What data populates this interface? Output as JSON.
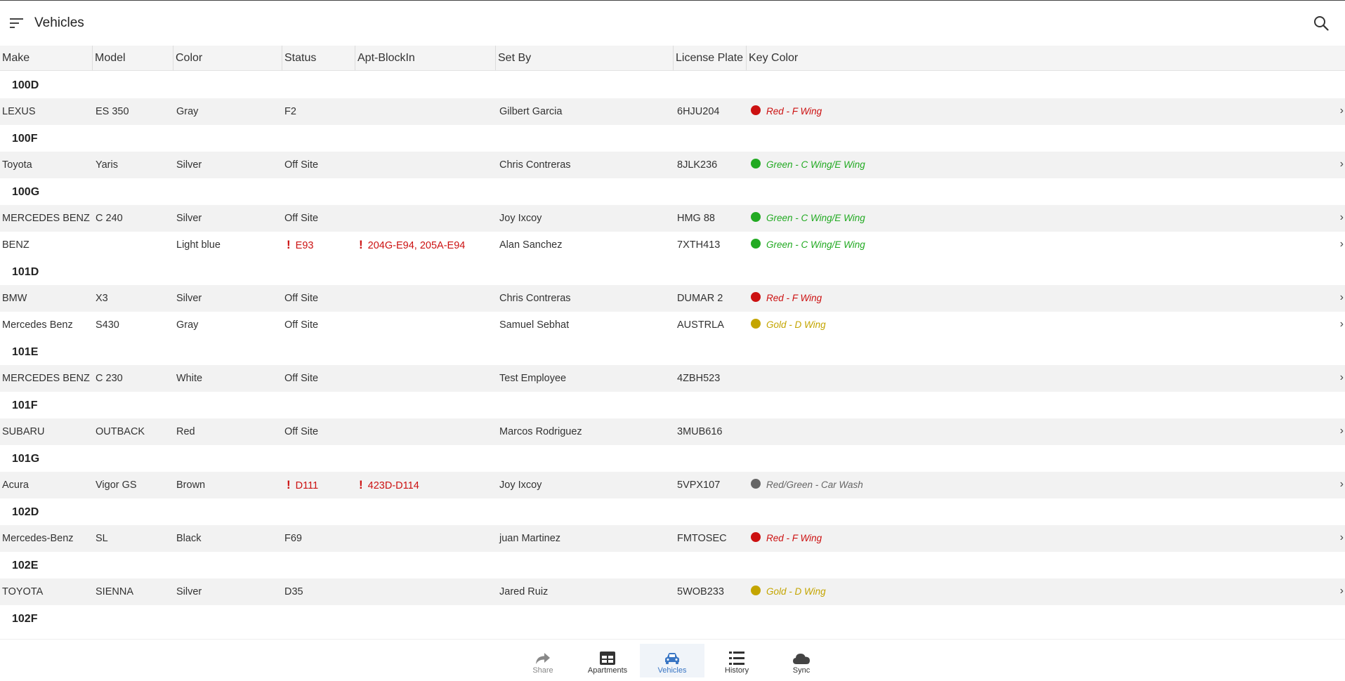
{
  "header": {
    "title": "Vehicles"
  },
  "columns": [
    "Make",
    "Model",
    "Color",
    "Status",
    "Apt-BlockIn",
    "Set By",
    "License Plate",
    "Key Color"
  ],
  "colors": {
    "red": "#cc1111",
    "green": "#22aa22",
    "gold": "#c4a500",
    "gray": "#666666",
    "active_tab": "#3a76c4"
  },
  "groups": [
    {
      "name": "100D",
      "rows": [
        {
          "make": "LEXUS",
          "model": "ES 350",
          "color": "Gray",
          "status": "F2",
          "status_alert": false,
          "apt": "",
          "apt_alert": false,
          "set_by": "Gilbert Garcia",
          "plate": "6HJU204",
          "key": "Red - F Wing",
          "key_color": "#cc1111"
        }
      ]
    },
    {
      "name": "100F",
      "rows": [
        {
          "make": "Toyota",
          "model": "Yaris",
          "color": "Silver",
          "status": "Off Site",
          "status_alert": false,
          "apt": "",
          "apt_alert": false,
          "set_by": "Chris Contreras",
          "plate": "8JLK236",
          "key": "Green - C Wing/E Wing",
          "key_color": "#22aa22"
        }
      ]
    },
    {
      "name": "100G",
      "rows": [
        {
          "make": "MERCEDES BENZ",
          "model": "C 240",
          "color": "Silver",
          "status": "Off Site",
          "status_alert": false,
          "apt": "",
          "apt_alert": false,
          "set_by": "Joy Ixcoy",
          "plate": "HMG 88",
          "key": "Green - C Wing/E Wing",
          "key_color": "#22aa22"
        },
        {
          "make": "BENZ",
          "model": "",
          "color": "Light blue",
          "status": "E93",
          "status_alert": true,
          "apt": "204G-E94, 205A-E94",
          "apt_alert": true,
          "set_by": "Alan Sanchez",
          "plate": "7XTH413",
          "key": "Green - C Wing/E Wing",
          "key_color": "#22aa22"
        }
      ]
    },
    {
      "name": "101D",
      "rows": [
        {
          "make": "BMW",
          "model": "X3",
          "color": "Silver",
          "status": "Off Site",
          "status_alert": false,
          "apt": "",
          "apt_alert": false,
          "set_by": "Chris Contreras",
          "plate": "DUMAR 2",
          "key": "Red - F Wing",
          "key_color": "#cc1111"
        },
        {
          "make": "Mercedes Benz",
          "model": "S430",
          "color": "Gray",
          "status": "Off Site",
          "status_alert": false,
          "apt": "",
          "apt_alert": false,
          "set_by": "Samuel Sebhat",
          "plate": "AUSTRLA",
          "key": "Gold - D Wing",
          "key_color": "#c4a500"
        }
      ]
    },
    {
      "name": "101E",
      "rows": [
        {
          "make": "MERCEDES BENZ",
          "model": "C 230",
          "color": "White",
          "status": "Off Site",
          "status_alert": false,
          "apt": "",
          "apt_alert": false,
          "set_by": "Test Employee",
          "plate": "4ZBH523",
          "key": "",
          "key_color": ""
        }
      ]
    },
    {
      "name": "101F",
      "rows": [
        {
          "make": "SUBARU",
          "model": "OUTBACK",
          "color": "Red",
          "status": "Off Site",
          "status_alert": false,
          "apt": "",
          "apt_alert": false,
          "set_by": "Marcos Rodriguez",
          "plate": "3MUB616",
          "key": "",
          "key_color": ""
        }
      ]
    },
    {
      "name": "101G",
      "rows": [
        {
          "make": "Acura",
          "model": "Vigor GS",
          "color": "Brown",
          "status": "D111",
          "status_alert": true,
          "apt": "423D-D114",
          "apt_alert": true,
          "set_by": "Joy Ixcoy",
          "plate": "5VPX107",
          "key": "Red/Green - Car Wash",
          "key_color": "#666666"
        }
      ]
    },
    {
      "name": "102D",
      "rows": [
        {
          "make": "Mercedes-Benz",
          "model": "SL",
          "color": "Black",
          "status": "F69",
          "status_alert": false,
          "apt": "",
          "apt_alert": false,
          "set_by": "juan Martinez",
          "plate": "FMTOSEC",
          "key": "Red - F Wing",
          "key_color": "#cc1111"
        }
      ]
    },
    {
      "name": "102E",
      "rows": [
        {
          "make": "TOYOTA",
          "model": "SIENNA",
          "color": "Silver",
          "status": "D35",
          "status_alert": false,
          "apt": "",
          "apt_alert": false,
          "set_by": "Jared Ruiz",
          "plate": "5WOB233",
          "key": "Gold - D Wing",
          "key_color": "#c4a500"
        }
      ]
    },
    {
      "name": "102F",
      "rows": []
    }
  ],
  "bottom_nav": [
    {
      "label": "Share",
      "icon": "share-icon",
      "active": false
    },
    {
      "label": "Apartments",
      "icon": "apartments-icon",
      "active": false
    },
    {
      "label": "Vehicles",
      "icon": "car-icon",
      "active": true
    },
    {
      "label": "History",
      "icon": "list-icon",
      "active": false
    },
    {
      "label": "Sync",
      "icon": "cloud-icon",
      "active": false
    }
  ]
}
